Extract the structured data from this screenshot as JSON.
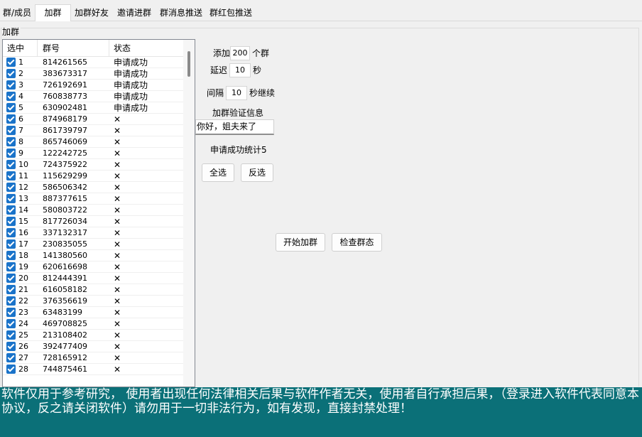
{
  "tabs": [
    {
      "label": "群/成员"
    },
    {
      "label": "加群",
      "active": true
    },
    {
      "label": "加群好友"
    },
    {
      "label": "邀请进群"
    },
    {
      "label": "群消息推送"
    },
    {
      "label": "群红包推送"
    }
  ],
  "group": {
    "title": "加群"
  },
  "list": {
    "headers": {
      "select": "选中",
      "group_no": "群号",
      "status": "状态"
    },
    "rows": [
      {
        "idx": "1",
        "num": "814261565",
        "status": "申请成功",
        "checked": true
      },
      {
        "idx": "2",
        "num": "383673317",
        "status": "申请成功",
        "checked": true
      },
      {
        "idx": "3",
        "num": "726192691",
        "status": "申请成功",
        "checked": true
      },
      {
        "idx": "4",
        "num": "760838773",
        "status": "申请成功",
        "checked": true
      },
      {
        "idx": "5",
        "num": "630902481",
        "status": "申请成功",
        "checked": true
      },
      {
        "idx": "6",
        "num": "874968179",
        "status": "✕",
        "checked": true
      },
      {
        "idx": "7",
        "num": "861739797",
        "status": "✕",
        "checked": true
      },
      {
        "idx": "8",
        "num": "865746069",
        "status": "✕",
        "checked": true
      },
      {
        "idx": "9",
        "num": "122242725",
        "status": "✕",
        "checked": true
      },
      {
        "idx": "10",
        "num": "724375922",
        "status": "✕",
        "checked": true
      },
      {
        "idx": "11",
        "num": "115629299",
        "status": "✕",
        "checked": true
      },
      {
        "idx": "12",
        "num": "586506342",
        "status": "✕",
        "checked": true
      },
      {
        "idx": "13",
        "num": "887377615",
        "status": "✕",
        "checked": true
      },
      {
        "idx": "14",
        "num": "580803722",
        "status": "✕",
        "checked": true
      },
      {
        "idx": "15",
        "num": "817726034",
        "status": "✕",
        "checked": true
      },
      {
        "idx": "16",
        "num": "337132317",
        "status": "✕",
        "checked": true
      },
      {
        "idx": "17",
        "num": "230835055",
        "status": "✕",
        "checked": true
      },
      {
        "idx": "18",
        "num": "141380560",
        "status": "✕",
        "checked": true
      },
      {
        "idx": "19",
        "num": "620616698",
        "status": "✕",
        "checked": true
      },
      {
        "idx": "20",
        "num": "812444391",
        "status": "✕",
        "checked": true
      },
      {
        "idx": "21",
        "num": "616058182",
        "status": "✕",
        "checked": true
      },
      {
        "idx": "22",
        "num": "376356619",
        "status": "✕",
        "checked": true
      },
      {
        "idx": "23",
        "num": "63483199",
        "status": "✕",
        "checked": true
      },
      {
        "idx": "24",
        "num": "469708825",
        "status": "✕",
        "checked": true
      },
      {
        "idx": "25",
        "num": "213108402",
        "status": "✕",
        "checked": true
      },
      {
        "idx": "26",
        "num": "392477409",
        "status": "✕",
        "checked": true
      },
      {
        "idx": "27",
        "num": "728165912",
        "status": "✕",
        "checked": true
      },
      {
        "idx": "28",
        "num": "744875461",
        "status": "✕",
        "checked": true
      }
    ]
  },
  "form": {
    "add_prefix": "添加",
    "add_value": "200",
    "add_suffix": "个群",
    "delay_prefix": "延迟",
    "delay_value": "10",
    "delay_suffix": "秒",
    "interval_prefix": "间隔",
    "interval_value": "10",
    "interval_suffix": "秒继续",
    "verify_label": "加群验证信息",
    "verify_value": "你好，姐夫来了",
    "success_stat": "申请成功统计5",
    "select_all": "全选",
    "invert": "反选",
    "start": "开始加群",
    "check": "检查群态"
  },
  "footer": {
    "text": "软件仅用于参考研究，   使用者出现任何法律相关后果与软件作者无关，使用者自行承担后果，（登录进入软件代表同意本协议，反之请关闭软件）请勿用于一切非法行为，如有发现，直接封禁处理！"
  },
  "colors": {
    "checkbox": "#1a73c9",
    "footer_bg": "#0b7078"
  }
}
